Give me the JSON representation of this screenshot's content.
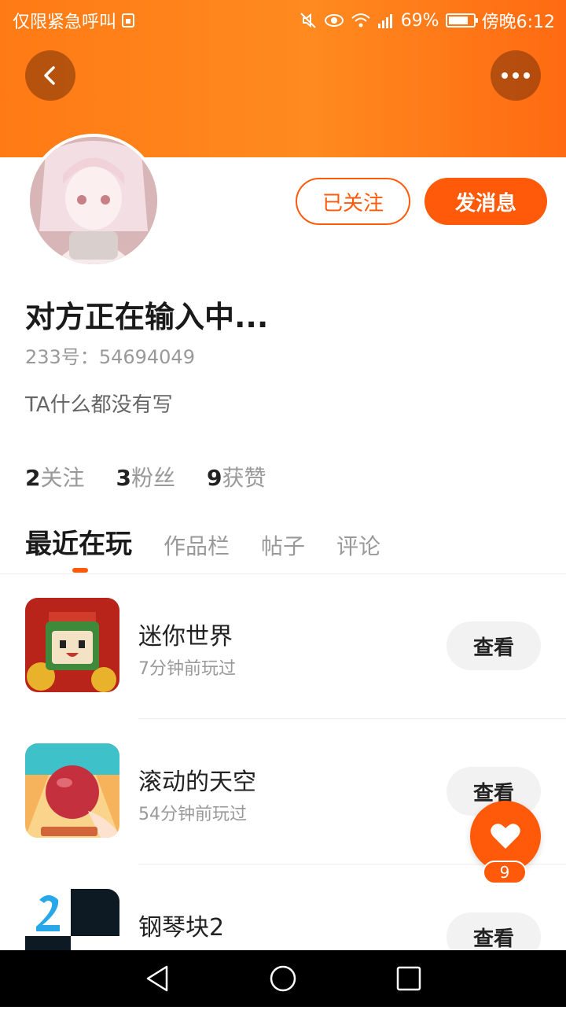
{
  "status_bar": {
    "carrier": "仅限紧急呼叫",
    "battery": "69%",
    "time": "傍晚6:12"
  },
  "header": {
    "back_icon": "chevron-left-icon",
    "more_icon": "more-dots-icon",
    "gradient_colors": [
      "#ff7a14",
      "#ff6a12"
    ]
  },
  "profile": {
    "follow_label": "已关注",
    "message_label": "发消息",
    "username": "对方正在输入中...",
    "id_label": "233号：",
    "id_value": "54694049",
    "bio": "TA什么都没有写"
  },
  "stats": [
    {
      "count": "2",
      "label": "关注"
    },
    {
      "count": "3",
      "label": "粉丝"
    },
    {
      "count": "9",
      "label": "获赞"
    }
  ],
  "tabs": [
    {
      "label": "最近在玩",
      "active": true
    },
    {
      "label": "作品栏",
      "active": false
    },
    {
      "label": "帖子",
      "active": false
    },
    {
      "label": "评论",
      "active": false
    }
  ],
  "games": [
    {
      "name": "迷你世界",
      "time": "7分钟前玩过",
      "button": "查看"
    },
    {
      "name": "滚动的天空",
      "time": "54分钟前玩过",
      "button": "查看"
    },
    {
      "name": "钢琴块2",
      "time": "",
      "button": "查看"
    }
  ],
  "fab": {
    "icon": "heart-icon",
    "count": "9"
  },
  "colors": {
    "accent": "#ff5a0a"
  }
}
